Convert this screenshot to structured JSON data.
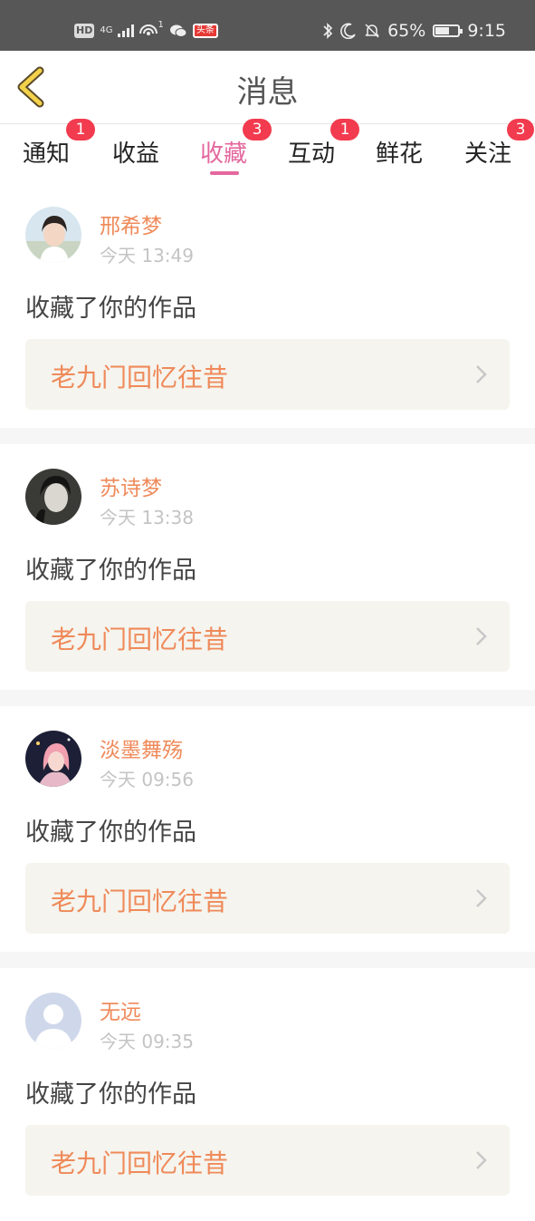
{
  "status_bar": {
    "hd": "HD",
    "net": "4G",
    "hotspot_count": "1",
    "app_badge": "头条",
    "battery_percent": "65%",
    "battery_level": 65,
    "time": "9:15",
    "icons": [
      "hd-icon",
      "signal-icon",
      "hotspot-icon",
      "wechat-icon",
      "app-icon",
      "bluetooth-icon",
      "moon-icon",
      "bell-off-icon",
      "battery-icon"
    ]
  },
  "header": {
    "title": "消息",
    "back_icon": "chevron-left-icon"
  },
  "tabs": [
    {
      "label": "通知",
      "badge": "1"
    },
    {
      "label": "收益",
      "badge": ""
    },
    {
      "label": "收藏",
      "badge": "3",
      "active": true
    },
    {
      "label": "互动",
      "badge": "1"
    },
    {
      "label": "鲜花",
      "badge": ""
    },
    {
      "label": "关注",
      "badge": "3"
    }
  ],
  "colors": {
    "accent": "#e4689e",
    "name": "#ef8a5a",
    "badge": "#f23b4e"
  },
  "items": [
    {
      "user": "邢希梦",
      "time": "今天 13:49",
      "action": "收藏了你的作品",
      "work": "老九门回忆往昔"
    },
    {
      "user": "苏诗梦",
      "time": "今天 13:38",
      "action": "收藏了你的作品",
      "work": "老九门回忆往昔"
    },
    {
      "user": "淡墨舞殇",
      "time": "今天 09:56",
      "action": "收藏了你的作品",
      "work": "老九门回忆往昔"
    },
    {
      "user": "无远",
      "time": "今天 09:35",
      "action": "收藏了你的作品",
      "work": "老九门回忆往昔"
    }
  ]
}
